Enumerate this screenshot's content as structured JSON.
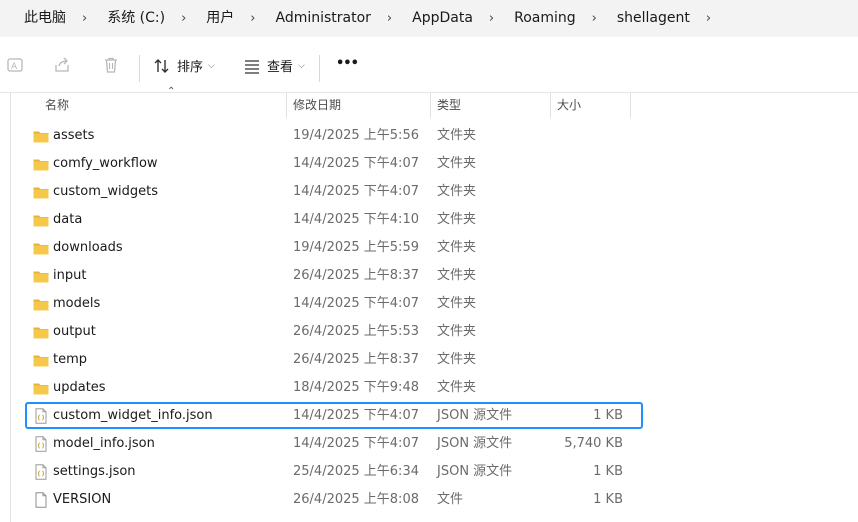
{
  "breadcrumb": [
    "此电脑",
    "系统 (C:)",
    "用户",
    "Administrator",
    "AppData",
    "Roaming",
    "shellagent"
  ],
  "toolbar": {
    "sort_label": "排序",
    "view_label": "查看",
    "more_label": "•••"
  },
  "columns": {
    "name": "名称",
    "date": "修改日期",
    "type": "类型",
    "size": "大小"
  },
  "files": [
    {
      "name": "assets",
      "date": "19/4/2025 上午5:56",
      "type": "文件夹",
      "size": "",
      "icon": "folder-icon"
    },
    {
      "name": "comfy_workflow",
      "date": "14/4/2025 下午4:07",
      "type": "文件夹",
      "size": "",
      "icon": "folder-icon"
    },
    {
      "name": "custom_widgets",
      "date": "14/4/2025 下午4:07",
      "type": "文件夹",
      "size": "",
      "icon": "folder-icon"
    },
    {
      "name": "data",
      "date": "14/4/2025 下午4:10",
      "type": "文件夹",
      "size": "",
      "icon": "folder-icon"
    },
    {
      "name": "downloads",
      "date": "19/4/2025 上午5:59",
      "type": "文件夹",
      "size": "",
      "icon": "folder-icon"
    },
    {
      "name": "input",
      "date": "26/4/2025 上午8:37",
      "type": "文件夹",
      "size": "",
      "icon": "folder-icon"
    },
    {
      "name": "models",
      "date": "14/4/2025 下午4:07",
      "type": "文件夹",
      "size": "",
      "icon": "folder-icon"
    },
    {
      "name": "output",
      "date": "26/4/2025 上午5:53",
      "type": "文件夹",
      "size": "",
      "icon": "folder-icon"
    },
    {
      "name": "temp",
      "date": "26/4/2025 上午8:37",
      "type": "文件夹",
      "size": "",
      "icon": "folder-icon"
    },
    {
      "name": "updates",
      "date": "18/4/2025 下午9:48",
      "type": "文件夹",
      "size": "",
      "icon": "folder-icon"
    },
    {
      "name": "custom_widget_info.json",
      "date": "14/4/2025 下午4:07",
      "type": "JSON 源文件",
      "size": "1 KB",
      "icon": "json-file-icon",
      "selected": true
    },
    {
      "name": "model_info.json",
      "date": "14/4/2025 下午4:07",
      "type": "JSON 源文件",
      "size": "5,740 KB",
      "icon": "json-file-icon"
    },
    {
      "name": "settings.json",
      "date": "25/4/2025 上午6:34",
      "type": "JSON 源文件",
      "size": "1 KB",
      "icon": "json-file-icon"
    },
    {
      "name": "VERSION",
      "date": "26/4/2025 上午8:08",
      "type": "文件",
      "size": "1 KB",
      "icon": "file-icon"
    }
  ],
  "colors": {
    "selection_border": "#1e90ff",
    "folder": "#f0c44a",
    "breadcrumb_bg": "#f3f3f3"
  }
}
